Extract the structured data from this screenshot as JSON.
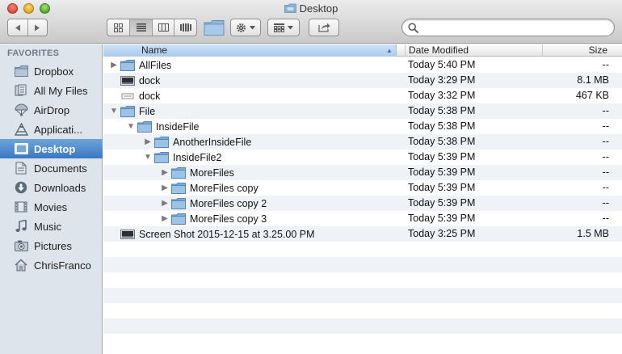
{
  "window": {
    "title": "Desktop"
  },
  "toolbar": {
    "back_icon": "triangle-left",
    "forward_icon": "triangle-right",
    "views": [
      "icon-view",
      "list-view",
      "column-view",
      "coverflow-view"
    ],
    "active_view": "list-view",
    "search_placeholder": ""
  },
  "sidebar": {
    "header": "FAVORITES",
    "items": [
      {
        "label": "Dropbox",
        "icon": "folder-icon"
      },
      {
        "label": "All My Files",
        "icon": "all-files-icon"
      },
      {
        "label": "AirDrop",
        "icon": "airdrop-icon"
      },
      {
        "label": "Applicati...",
        "icon": "applications-icon"
      },
      {
        "label": "Desktop",
        "icon": "desktop-icon",
        "selected": true
      },
      {
        "label": "Documents",
        "icon": "documents-icon"
      },
      {
        "label": "Downloads",
        "icon": "downloads-icon"
      },
      {
        "label": "Movies",
        "icon": "movies-icon"
      },
      {
        "label": "Music",
        "icon": "music-icon"
      },
      {
        "label": "Pictures",
        "icon": "pictures-icon"
      },
      {
        "label": "ChrisFranco",
        "icon": "home-icon"
      }
    ]
  },
  "columns": {
    "name": "Name",
    "date": "Date Modified",
    "size": "Size"
  },
  "rows": [
    {
      "name": "AllFiles",
      "date": "Today 5:40 PM",
      "size": "--",
      "level": 0,
      "disclosure": "collapsed",
      "kind": "folder"
    },
    {
      "name": "dock",
      "date": "Today 3:29 PM",
      "size": "8.1 MB",
      "level": 0,
      "disclosure": "none",
      "kind": "image"
    },
    {
      "name": "dock",
      "date": "Today 3:32 PM",
      "size": "467 KB",
      "level": 0,
      "disclosure": "none",
      "kind": "doc"
    },
    {
      "name": "File",
      "date": "Today 5:38 PM",
      "size": "--",
      "level": 0,
      "disclosure": "expanded",
      "kind": "folder"
    },
    {
      "name": "InsideFile",
      "date": "Today 5:38 PM",
      "size": "--",
      "level": 1,
      "disclosure": "expanded",
      "kind": "folder"
    },
    {
      "name": "AnotherInsideFile",
      "date": "Today 5:38 PM",
      "size": "--",
      "level": 2,
      "disclosure": "collapsed",
      "kind": "folder"
    },
    {
      "name": "InsideFile2",
      "date": "Today 5:39 PM",
      "size": "--",
      "level": 2,
      "disclosure": "expanded",
      "kind": "folder"
    },
    {
      "name": "MoreFiles",
      "date": "Today 5:39 PM",
      "size": "--",
      "level": 3,
      "disclosure": "collapsed",
      "kind": "folder"
    },
    {
      "name": "MoreFiles copy",
      "date": "Today 5:39 PM",
      "size": "--",
      "level": 3,
      "disclosure": "collapsed",
      "kind": "folder"
    },
    {
      "name": "MoreFiles copy 2",
      "date": "Today 5:39 PM",
      "size": "--",
      "level": 3,
      "disclosure": "collapsed",
      "kind": "folder"
    },
    {
      "name": "MoreFiles copy 3",
      "date": "Today 5:39 PM",
      "size": "--",
      "level": 3,
      "disclosure": "collapsed",
      "kind": "folder"
    },
    {
      "name": "Screen Shot 2015-12-15 at 3.25.00 PM",
      "date": "Today 3:25 PM",
      "size": "1.5 MB",
      "level": 0,
      "disclosure": "none",
      "kind": "image"
    }
  ],
  "colors": {
    "selection": "#3b78c4",
    "sidebar_bg": "#dde4ec",
    "row_alt": "#eff3f8",
    "folder": "#8fb7dc"
  }
}
